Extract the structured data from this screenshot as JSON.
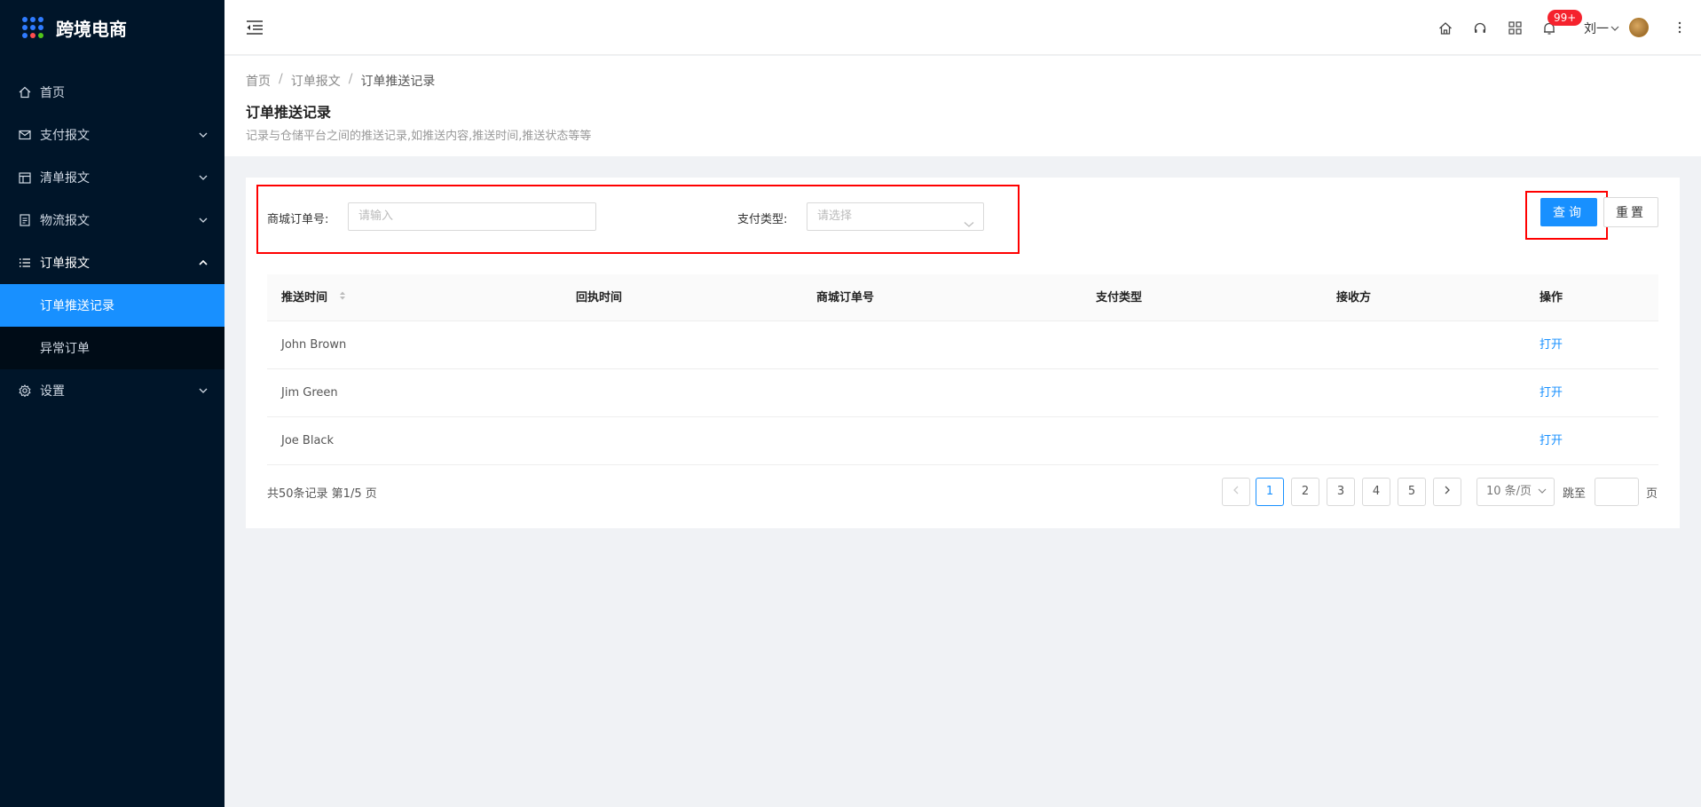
{
  "app": {
    "title": "跨境电商"
  },
  "colors": {
    "sidebar_bg": "#001529",
    "accent": "#1890ff",
    "highlight": "#ff0000",
    "badge": "#f5222d"
  },
  "sidebar": {
    "items": [
      {
        "label": "首页",
        "icon": "home-icon",
        "has_arrow": false
      },
      {
        "label": "支付报文",
        "icon": "mail-icon",
        "has_arrow": true
      },
      {
        "label": "清单报文",
        "icon": "table-icon",
        "has_arrow": true
      },
      {
        "label": "物流报文",
        "icon": "file-icon",
        "has_arrow": true
      },
      {
        "label": "订单报文",
        "icon": "list-icon",
        "has_arrow": true,
        "open": true
      },
      {
        "label": "设置",
        "icon": "gear-icon",
        "has_arrow": true
      }
    ],
    "submenu": [
      {
        "label": "订单推送记录",
        "active": true
      },
      {
        "label": "异常订单",
        "active": false
      }
    ]
  },
  "header": {
    "badge": "99+",
    "user": "刘一",
    "icons": [
      "home-icon",
      "headset-icon",
      "apps-icon",
      "bell-icon",
      "more-icon"
    ]
  },
  "page": {
    "breadcrumb": [
      "首页",
      "订单报文",
      "订单推送记录"
    ],
    "title": "订单推送记录",
    "description": "记录与仓储平台之间的推送记录,如推送内容,推送时间,推送状态等等"
  },
  "filters": {
    "order_label": "商城订单号:",
    "order_placeholder": "请输入",
    "pay_label": "支付类型:",
    "pay_placeholder": "请选择",
    "query_button": "查询",
    "reset_button": "重置"
  },
  "table": {
    "columns": [
      "推送时间",
      "回执时间",
      "商城订单号",
      "支付类型",
      "接收方",
      "操作"
    ],
    "rows": [
      {
        "push_time": "John Brown",
        "action": "打开"
      },
      {
        "push_time": "Jim Green",
        "action": "打开"
      },
      {
        "push_time": "Joe Black",
        "action": "打开"
      }
    ]
  },
  "pagination": {
    "total_text": "共50条记录 第1/5 页",
    "pages": [
      "1",
      "2",
      "3",
      "4",
      "5"
    ],
    "current": 1,
    "page_size": "10 条/页",
    "jump_label": "跳至",
    "page_unit": "页"
  }
}
